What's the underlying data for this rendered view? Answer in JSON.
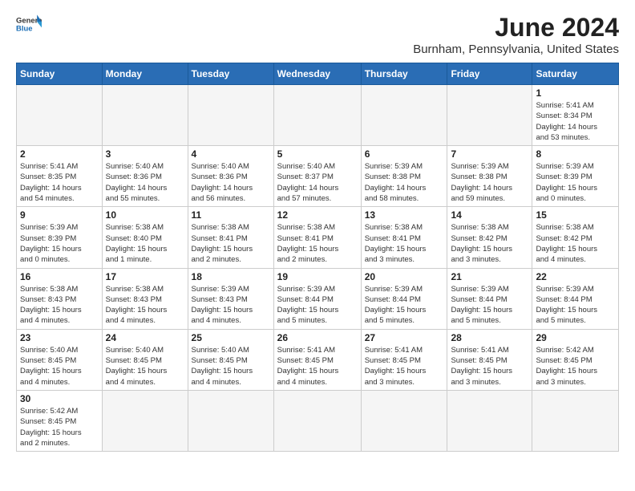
{
  "logo": {
    "general": "General",
    "blue": "Blue"
  },
  "title": "June 2024",
  "location": "Burnham, Pennsylvania, United States",
  "days_of_week": [
    "Sunday",
    "Monday",
    "Tuesday",
    "Wednesday",
    "Thursday",
    "Friday",
    "Saturday"
  ],
  "weeks": [
    [
      {
        "day": "",
        "info": ""
      },
      {
        "day": "",
        "info": ""
      },
      {
        "day": "",
        "info": ""
      },
      {
        "day": "",
        "info": ""
      },
      {
        "day": "",
        "info": ""
      },
      {
        "day": "",
        "info": ""
      },
      {
        "day": "1",
        "info": "Sunrise: 5:41 AM\nSunset: 8:34 PM\nDaylight: 14 hours\nand 53 minutes."
      }
    ],
    [
      {
        "day": "2",
        "info": "Sunrise: 5:41 AM\nSunset: 8:35 PM\nDaylight: 14 hours\nand 54 minutes."
      },
      {
        "day": "3",
        "info": "Sunrise: 5:40 AM\nSunset: 8:36 PM\nDaylight: 14 hours\nand 55 minutes."
      },
      {
        "day": "4",
        "info": "Sunrise: 5:40 AM\nSunset: 8:36 PM\nDaylight: 14 hours\nand 56 minutes."
      },
      {
        "day": "5",
        "info": "Sunrise: 5:40 AM\nSunset: 8:37 PM\nDaylight: 14 hours\nand 57 minutes."
      },
      {
        "day": "6",
        "info": "Sunrise: 5:39 AM\nSunset: 8:38 PM\nDaylight: 14 hours\nand 58 minutes."
      },
      {
        "day": "7",
        "info": "Sunrise: 5:39 AM\nSunset: 8:38 PM\nDaylight: 14 hours\nand 59 minutes."
      },
      {
        "day": "8",
        "info": "Sunrise: 5:39 AM\nSunset: 8:39 PM\nDaylight: 15 hours\nand 0 minutes."
      }
    ],
    [
      {
        "day": "9",
        "info": "Sunrise: 5:39 AM\nSunset: 8:39 PM\nDaylight: 15 hours\nand 0 minutes."
      },
      {
        "day": "10",
        "info": "Sunrise: 5:38 AM\nSunset: 8:40 PM\nDaylight: 15 hours\nand 1 minute."
      },
      {
        "day": "11",
        "info": "Sunrise: 5:38 AM\nSunset: 8:41 PM\nDaylight: 15 hours\nand 2 minutes."
      },
      {
        "day": "12",
        "info": "Sunrise: 5:38 AM\nSunset: 8:41 PM\nDaylight: 15 hours\nand 2 minutes."
      },
      {
        "day": "13",
        "info": "Sunrise: 5:38 AM\nSunset: 8:41 PM\nDaylight: 15 hours\nand 3 minutes."
      },
      {
        "day": "14",
        "info": "Sunrise: 5:38 AM\nSunset: 8:42 PM\nDaylight: 15 hours\nand 3 minutes."
      },
      {
        "day": "15",
        "info": "Sunrise: 5:38 AM\nSunset: 8:42 PM\nDaylight: 15 hours\nand 4 minutes."
      }
    ],
    [
      {
        "day": "16",
        "info": "Sunrise: 5:38 AM\nSunset: 8:43 PM\nDaylight: 15 hours\nand 4 minutes."
      },
      {
        "day": "17",
        "info": "Sunrise: 5:38 AM\nSunset: 8:43 PM\nDaylight: 15 hours\nand 4 minutes."
      },
      {
        "day": "18",
        "info": "Sunrise: 5:39 AM\nSunset: 8:43 PM\nDaylight: 15 hours\nand 4 minutes."
      },
      {
        "day": "19",
        "info": "Sunrise: 5:39 AM\nSunset: 8:44 PM\nDaylight: 15 hours\nand 5 minutes."
      },
      {
        "day": "20",
        "info": "Sunrise: 5:39 AM\nSunset: 8:44 PM\nDaylight: 15 hours\nand 5 minutes."
      },
      {
        "day": "21",
        "info": "Sunrise: 5:39 AM\nSunset: 8:44 PM\nDaylight: 15 hours\nand 5 minutes."
      },
      {
        "day": "22",
        "info": "Sunrise: 5:39 AM\nSunset: 8:44 PM\nDaylight: 15 hours\nand 5 minutes."
      }
    ],
    [
      {
        "day": "23",
        "info": "Sunrise: 5:40 AM\nSunset: 8:45 PM\nDaylight: 15 hours\nand 4 minutes."
      },
      {
        "day": "24",
        "info": "Sunrise: 5:40 AM\nSunset: 8:45 PM\nDaylight: 15 hours\nand 4 minutes."
      },
      {
        "day": "25",
        "info": "Sunrise: 5:40 AM\nSunset: 8:45 PM\nDaylight: 15 hours\nand 4 minutes."
      },
      {
        "day": "26",
        "info": "Sunrise: 5:41 AM\nSunset: 8:45 PM\nDaylight: 15 hours\nand 4 minutes."
      },
      {
        "day": "27",
        "info": "Sunrise: 5:41 AM\nSunset: 8:45 PM\nDaylight: 15 hours\nand 3 minutes."
      },
      {
        "day": "28",
        "info": "Sunrise: 5:41 AM\nSunset: 8:45 PM\nDaylight: 15 hours\nand 3 minutes."
      },
      {
        "day": "29",
        "info": "Sunrise: 5:42 AM\nSunset: 8:45 PM\nDaylight: 15 hours\nand 3 minutes."
      }
    ],
    [
      {
        "day": "30",
        "info": "Sunrise: 5:42 AM\nSunset: 8:45 PM\nDaylight: 15 hours\nand 2 minutes."
      },
      {
        "day": "",
        "info": ""
      },
      {
        "day": "",
        "info": ""
      },
      {
        "day": "",
        "info": ""
      },
      {
        "day": "",
        "info": ""
      },
      {
        "day": "",
        "info": ""
      },
      {
        "day": "",
        "info": ""
      }
    ]
  ]
}
